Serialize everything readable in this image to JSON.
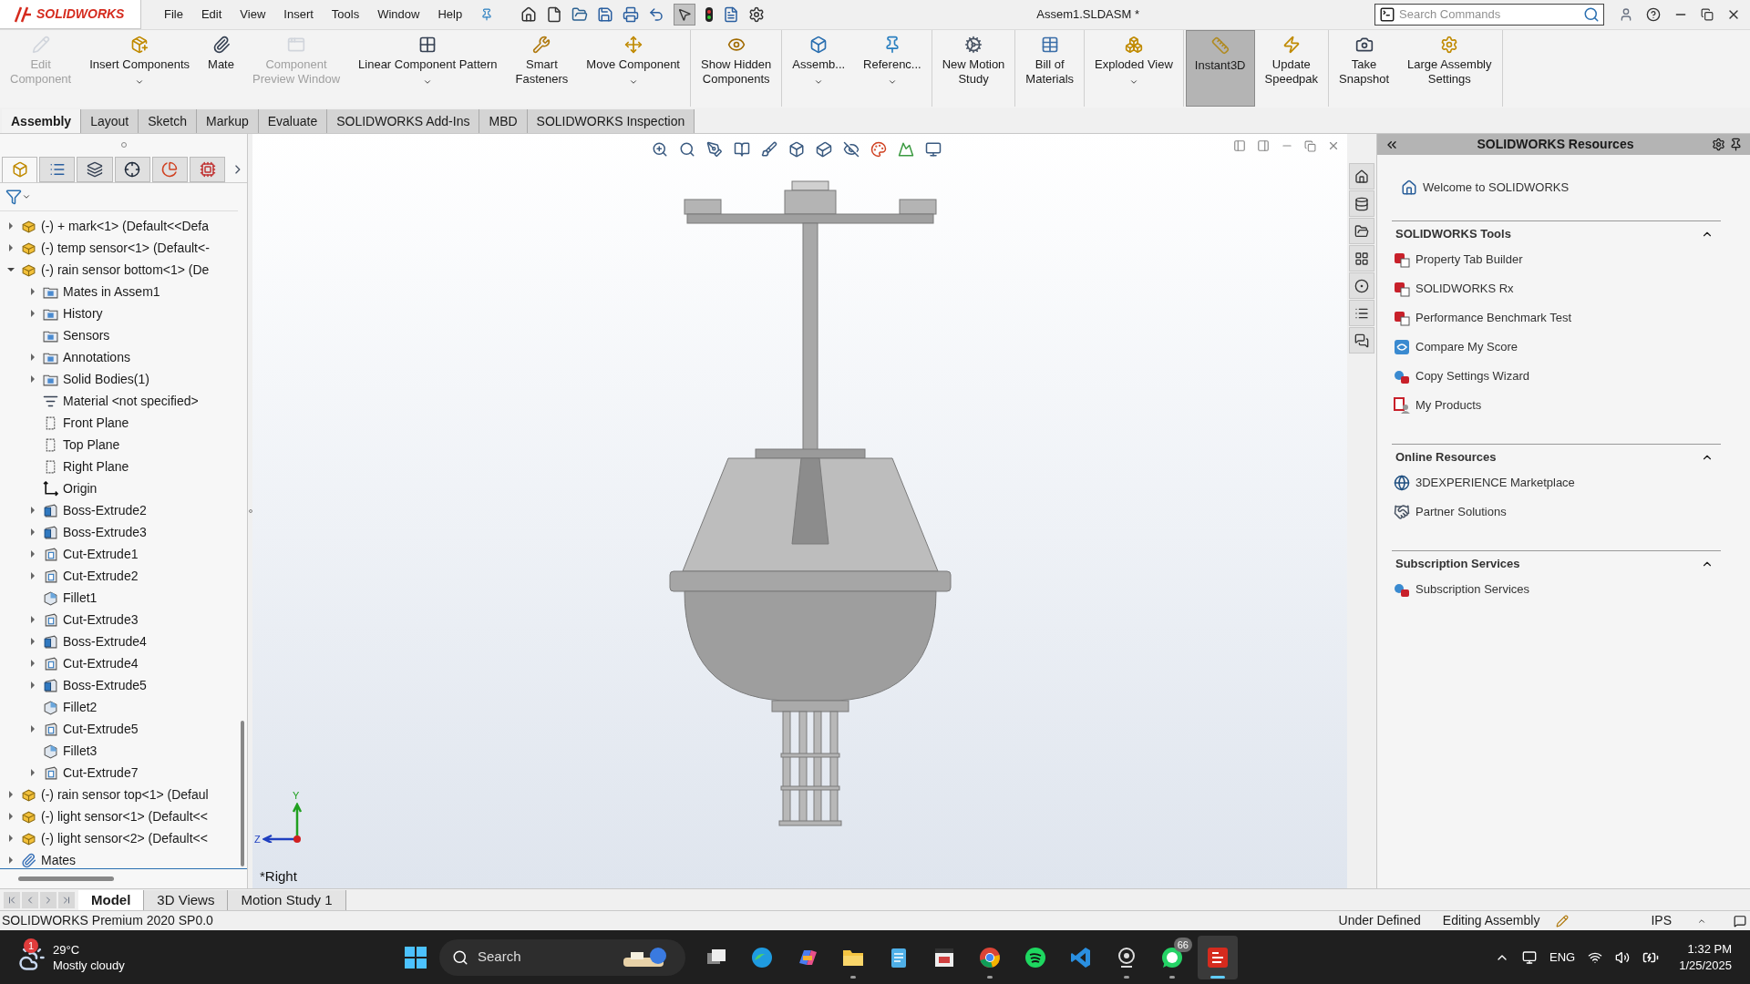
{
  "title_bar": {
    "logo": "SOLIDWORKS",
    "menu": [
      "File",
      "Edit",
      "View",
      "Insert",
      "Tools",
      "Window",
      "Help"
    ],
    "select_tool_active": true,
    "document_title": "Assem1.SLDASM *",
    "search": {
      "placeholder": "Search Commands"
    }
  },
  "ribbon": {
    "groups": [
      [
        {
          "label": "Edit\nComponent",
          "kind": "pencil",
          "disabled": true,
          "dropdown": false,
          "selected": false
        },
        {
          "label": "Insert Components",
          "kind": "insert",
          "disabled": false,
          "dropdown": true,
          "selected": false
        },
        {
          "label": "Mate",
          "kind": "clip",
          "disabled": false,
          "dropdown": false,
          "selected": false
        },
        {
          "label": "Component\nPreview Window",
          "kind": "window",
          "disabled": true,
          "dropdown": false,
          "selected": false
        },
        {
          "label": "Linear Component Pattern",
          "kind": "pattern",
          "disabled": false,
          "dropdown": true,
          "selected": false
        },
        {
          "label": "Smart\nFasteners",
          "kind": "wrench",
          "disabled": false,
          "dropdown": false,
          "selected": false
        },
        {
          "label": "Move Component",
          "kind": "move",
          "disabled": false,
          "dropdown": true,
          "selected": false
        }
      ],
      [
        {
          "label": "Show Hidden\nComponents",
          "kind": "eye",
          "disabled": false,
          "dropdown": false,
          "selected": false
        }
      ],
      [
        {
          "label": "Assemb...",
          "kind": "box",
          "disabled": false,
          "dropdown": true,
          "selected": false
        },
        {
          "label": "Referenc...",
          "kind": "pin",
          "disabled": false,
          "dropdown": true,
          "selected": false
        }
      ],
      [
        {
          "label": "New Motion\nStudy",
          "kind": "cog",
          "disabled": false,
          "dropdown": false,
          "selected": false
        }
      ],
      [
        {
          "label": "Bill of\nMaterials",
          "kind": "table",
          "disabled": false,
          "dropdown": false,
          "selected": false
        }
      ],
      [
        {
          "label": "Exploded View",
          "kind": "boxes",
          "disabled": false,
          "dropdown": true,
          "selected": false
        }
      ],
      [
        {
          "label": "Instant3D",
          "kind": "ruler",
          "disabled": false,
          "dropdown": false,
          "selected": true
        },
        {
          "label": "Update\nSpeedpak",
          "kind": "zap",
          "disabled": false,
          "dropdown": false,
          "selected": false
        }
      ],
      [
        {
          "label": "Take\nSnapshot",
          "kind": "camera",
          "disabled": false,
          "dropdown": false,
          "selected": false
        },
        {
          "label": "Large Assembly\nSettings",
          "kind": "settings",
          "disabled": false,
          "dropdown": false,
          "selected": false
        }
      ]
    ]
  },
  "command_tabs": [
    {
      "label": "Assembly",
      "selected": true
    },
    {
      "label": "Layout",
      "selected": false
    },
    {
      "label": "Sketch",
      "selected": false
    },
    {
      "label": "Markup",
      "selected": false
    },
    {
      "label": "Evaluate",
      "selected": false
    },
    {
      "label": "SOLIDWORKS Add-Ins",
      "selected": false
    },
    {
      "label": "MBD",
      "selected": false
    },
    {
      "label": "SOLIDWORKS Inspection",
      "selected": false
    }
  ],
  "feature_tree": {
    "tabs": [
      {
        "kind": "part",
        "selected": true
      },
      {
        "kind": "list",
        "selected": false
      },
      {
        "kind": "config",
        "selected": false
      },
      {
        "kind": "target",
        "selected": false
      },
      {
        "kind": "display",
        "selected": false
      },
      {
        "kind": "cam",
        "selected": false
      }
    ],
    "items": [
      {
        "label": "(-) + mark<1> (Default<<Defa",
        "kind": "part",
        "expanded": false
      },
      {
        "label": "(-) temp sensor<1> (Default<-",
        "kind": "part",
        "expanded": false
      },
      {
        "label": "(-) rain sensor bottom<1> (De",
        "kind": "part",
        "expanded": true,
        "children": [
          {
            "label": "Mates in Assem1",
            "kind": "folder",
            "expanded": false
          },
          {
            "label": "History",
            "kind": "folder",
            "expanded": false
          },
          {
            "label": "Sensors",
            "kind": "folder"
          },
          {
            "label": "Annotations",
            "kind": "folder",
            "expanded": false
          },
          {
            "label": "Solid Bodies(1)",
            "kind": "folder",
            "expanded": false
          },
          {
            "label": "Material <not specified>",
            "kind": "material"
          },
          {
            "label": "Front Plane",
            "kind": "plane"
          },
          {
            "label": "Top Plane",
            "kind": "plane"
          },
          {
            "label": "Right Plane",
            "kind": "plane"
          },
          {
            "label": "Origin",
            "kind": "origin"
          },
          {
            "label": "Boss-Extrude2",
            "kind": "boss",
            "expanded": false
          },
          {
            "label": "Boss-Extrude3",
            "kind": "boss",
            "expanded": false
          },
          {
            "label": "Cut-Extrude1",
            "kind": "cut",
            "expanded": false
          },
          {
            "label": "Cut-Extrude2",
            "kind": "cut",
            "expanded": false
          },
          {
            "label": "Fillet1",
            "kind": "fillet"
          },
          {
            "label": "Cut-Extrude3",
            "kind": "cut",
            "expanded": false
          },
          {
            "label": "Boss-Extrude4",
            "kind": "boss",
            "expanded": false
          },
          {
            "label": "Cut-Extrude4",
            "kind": "cut",
            "expanded": false
          },
          {
            "label": "Boss-Extrude5",
            "kind": "boss",
            "expanded": false
          },
          {
            "label": "Fillet2",
            "kind": "fillet"
          },
          {
            "label": "Cut-Extrude5",
            "kind": "cut",
            "expanded": false
          },
          {
            "label": "Fillet3",
            "kind": "fillet"
          },
          {
            "label": "Cut-Extrude7",
            "kind": "cut",
            "expanded": false
          }
        ]
      },
      {
        "label": "(-) rain sensor top<1> (Defaul",
        "kind": "part",
        "expanded": false
      },
      {
        "label": "(-) light sensor<1> (Default<<",
        "kind": "part",
        "expanded": false
      },
      {
        "label": "(-) light sensor<2> (Default<<",
        "kind": "part",
        "expanded": false
      },
      {
        "label": "Mates",
        "kind": "mates",
        "expanded": false
      }
    ]
  },
  "viewport": {
    "view_label": "*Right",
    "triad": {
      "vertical": "Y",
      "horizontal": "Z"
    }
  },
  "bottom_tabs": [
    {
      "label": "Model",
      "selected": true
    },
    {
      "label": "3D Views",
      "selected": false
    },
    {
      "label": "Motion Study 1",
      "selected": false
    }
  ],
  "status_bar": {
    "product": "SOLIDWORKS Premium 2020 SP0.0",
    "state": "Under Defined",
    "mode": "Editing Assembly",
    "units": "IPS"
  },
  "resources_panel": {
    "title": "SOLIDWORKS Resources",
    "welcome": "Welcome to SOLIDWORKS",
    "sections": [
      {
        "title": "SOLIDWORKS Tools",
        "expanded": true,
        "items": [
          {
            "label": "Property Tab Builder",
            "kind": "sw"
          },
          {
            "label": "SOLIDWORKS Rx",
            "kind": "sw"
          },
          {
            "label": "Performance Benchmark Test",
            "kind": "sw"
          },
          {
            "label": "Compare My Score",
            "kind": "score"
          },
          {
            "label": "Copy Settings Wizard",
            "kind": "wizard"
          },
          {
            "label": "My Products",
            "kind": "products"
          }
        ]
      },
      {
        "title": "Online Resources",
        "expanded": true,
        "items": [
          {
            "label": "3DEXPERIENCE Marketplace",
            "kind": "globe"
          },
          {
            "label": "Partner Solutions",
            "kind": "handshake"
          }
        ]
      },
      {
        "title": "Subscription Services",
        "expanded": true,
        "items": [
          {
            "label": "Subscription Services",
            "kind": "wizard"
          }
        ]
      }
    ]
  },
  "taskbar": {
    "weather": {
      "badge": "1",
      "temperature": "29°C",
      "condition": "Mostly cloudy"
    },
    "search": {
      "placeholder": "Search"
    },
    "apps": [
      {
        "kind": "taskview",
        "running": false,
        "active": false
      },
      {
        "kind": "edge",
        "running": false,
        "active": false
      },
      {
        "kind": "copilot",
        "running": false,
        "active": false
      },
      {
        "kind": "explorer",
        "running": true,
        "active": false
      },
      {
        "kind": "notepad",
        "running": false,
        "active": false
      },
      {
        "kind": "media",
        "running": false,
        "active": false
      },
      {
        "kind": "chrome",
        "running": true,
        "active": false
      },
      {
        "kind": "spotify",
        "running": false,
        "active": false
      },
      {
        "kind": "vscode",
        "running": false,
        "active": false
      },
      {
        "kind": "camera",
        "running": true,
        "active": false
      },
      {
        "kind": "whatsapp",
        "running": true,
        "active": false,
        "badge": "66"
      },
      {
        "kind": "solidworks",
        "running": true,
        "active": true
      }
    ],
    "language": "ENG",
    "time": "1:32 PM",
    "date": "1/25/2025"
  }
}
